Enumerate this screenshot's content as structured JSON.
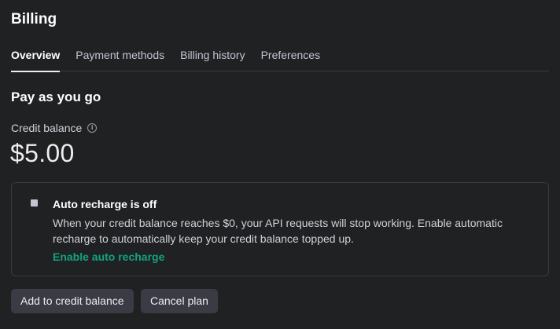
{
  "header": {
    "title": "Billing"
  },
  "tabs": [
    {
      "label": "Overview",
      "active": true
    },
    {
      "label": "Payment methods",
      "active": false
    },
    {
      "label": "Billing history",
      "active": false
    },
    {
      "label": "Preferences",
      "active": false
    }
  ],
  "plan": {
    "title": "Pay as you go"
  },
  "credit": {
    "label": "Credit balance",
    "info_icon": "info-icon",
    "amount": "$5.00"
  },
  "auto_recharge": {
    "title": "Auto recharge is off",
    "description": "When your credit balance reaches $0, your API requests will stop working. Enable automatic recharge to automatically keep your credit balance topped up.",
    "link_label": "Enable auto recharge",
    "status_icon": "status-square-icon"
  },
  "actions": {
    "add_label": "Add to credit balance",
    "cancel_label": "Cancel plan"
  },
  "colors": {
    "background": "#202123",
    "accent": "#10a37f",
    "button_bg": "#3a3b44",
    "border": "#3a3b40"
  }
}
